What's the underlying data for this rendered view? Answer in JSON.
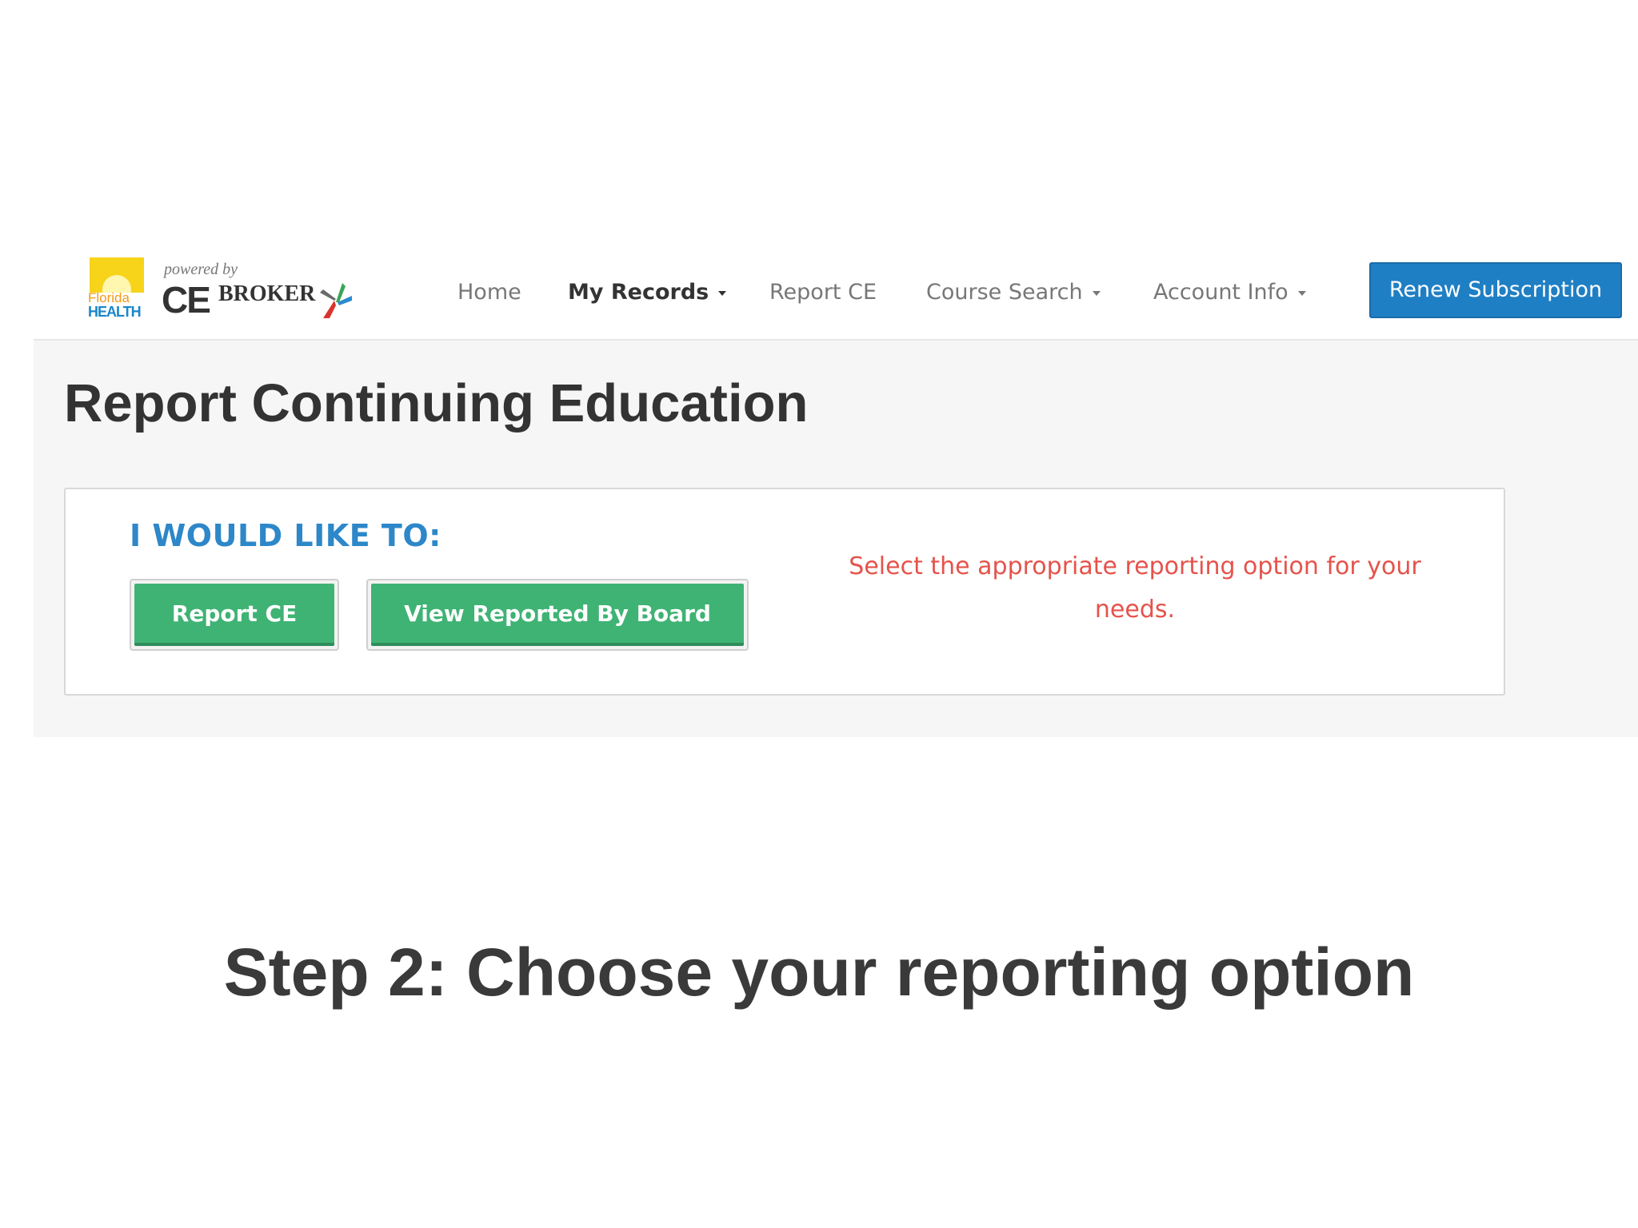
{
  "logo": {
    "partner_word": "Florida",
    "partner_health": "HEALTH",
    "powered_by": "powered by",
    "brand_ce": "CE",
    "brand_broker": "BROKER"
  },
  "nav": {
    "items": [
      {
        "label": "Home",
        "dropdown": false,
        "active": false
      },
      {
        "label": "My Records",
        "dropdown": true,
        "active": true
      },
      {
        "label": "Report CE",
        "dropdown": false,
        "active": false
      },
      {
        "label": "Course Search",
        "dropdown": true,
        "active": false
      },
      {
        "label": "Account Info",
        "dropdown": true,
        "active": false
      }
    ],
    "renew_label": "Renew Subscription"
  },
  "page": {
    "title": "Report Continuing Education"
  },
  "panel": {
    "lead": "I WOULD LIKE TO:",
    "report_button": "Report CE",
    "view_button": "View Reported By Board",
    "hint": "Select the appropriate reporting option for your needs."
  },
  "caption": "Step 2: Choose your reporting option",
  "colors": {
    "primary_blue": "#1f7fc4",
    "heading_blue": "#2d87c8",
    "action_green": "#3fb374",
    "hint_red": "#e5534b"
  }
}
